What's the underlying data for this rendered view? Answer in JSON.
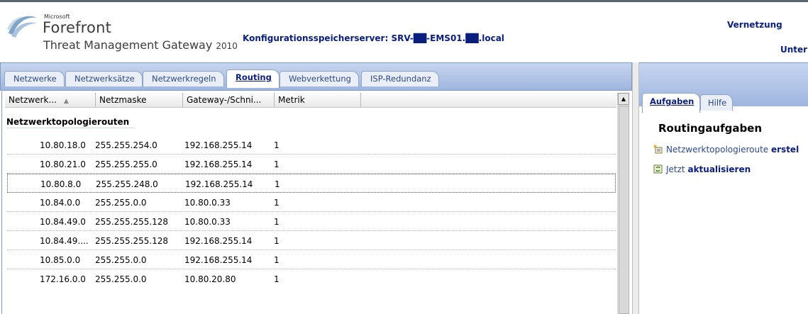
{
  "header": {
    "logo": {
      "microsoft": "Microsoft",
      "product": "Forefront",
      "subtitle": "Threat Management Gateway",
      "year": "2010"
    },
    "config_server": "Konfigurationsspeicherserver: SRV-██-EMS01.██.local",
    "nav_vernetzung": "Vernetzung",
    "nav_unter": "Unter"
  },
  "tabs": [
    {
      "label": "Netzwerke",
      "active": false
    },
    {
      "label": "Netzwerksätze",
      "active": false
    },
    {
      "label": "Netzwerkregeln",
      "active": false
    },
    {
      "label": "Routing",
      "active": true
    },
    {
      "label": "Webverkettung",
      "active": false
    },
    {
      "label": "ISP-Redundanz",
      "active": false
    }
  ],
  "grid": {
    "columns": [
      "Netzwerk...",
      "Netzmaske",
      "Gateway-/Schni...",
      "Metrik"
    ],
    "group_title": "Netzwerktopologierouten",
    "rows": [
      {
        "network": "10.80.18.0",
        "mask": "255.255.254.0",
        "gateway": "192.168.255.14",
        "metric": "1"
      },
      {
        "network": "10.80.21.0",
        "mask": "255.255.255.0",
        "gateway": "192.168.255.14",
        "metric": "1"
      },
      {
        "network": "10.80.8.0",
        "mask": "255.255.248.0",
        "gateway": "192.168.255.14",
        "metric": "1"
      },
      {
        "network": "10.84.0.0",
        "mask": "255.255.0.0",
        "gateway": "10.80.0.33",
        "metric": "1"
      },
      {
        "network": "10.84.49.0",
        "mask": "255.255.255.128",
        "gateway": "10.80.0.33",
        "metric": "1"
      },
      {
        "network": "10.84.49....",
        "mask": "255.255.255.128",
        "gateway": "192.168.255.14",
        "metric": "1"
      },
      {
        "network": "10.85.0.0",
        "mask": "255.255.0.0",
        "gateway": "192.168.255.14",
        "metric": "1"
      },
      {
        "network": "172.16.0.0",
        "mask": "255.255.0.0",
        "gateway": "10.80.20.80",
        "metric": "1"
      }
    ]
  },
  "right_panel": {
    "tabs": [
      {
        "label": "Aufgaben",
        "active": true
      },
      {
        "label": "Hilfe",
        "active": false
      }
    ],
    "tasks_title": "Routingaufgaben",
    "tasks": [
      {
        "text": "Netzwerktopologieroute",
        "bold": "erstel",
        "icon": "new-route-icon"
      },
      {
        "text": "Jetzt",
        "bold": "aktualisieren",
        "icon": "refresh-icon"
      }
    ]
  }
}
